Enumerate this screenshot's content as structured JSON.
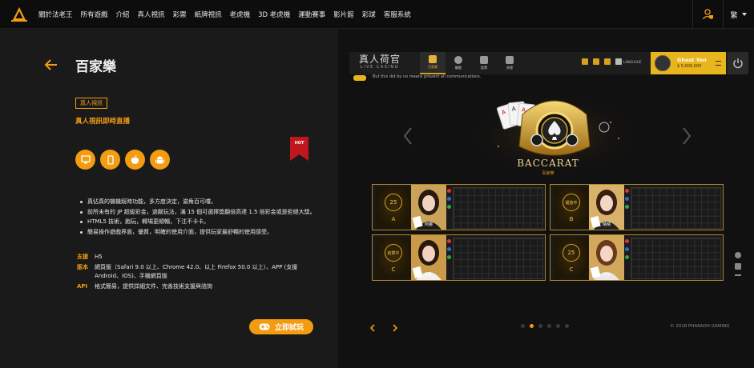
{
  "nav": {
    "items": [
      "關於法老王",
      "所有遊戲",
      "介紹",
      "真人視訊",
      "彩票",
      "紙牌視訊",
      "老虎機",
      "3D 老虎機",
      "運動賽事",
      "影片館",
      "彩球",
      "客服系統"
    ],
    "user_icon": "user-lock-icon",
    "language_label": "繁",
    "accent": "#f39c12"
  },
  "product": {
    "title": "百家樂",
    "tag": "真人視訊",
    "subtitle": "真人視訊即時直播",
    "hot_label": "HOT",
    "platforms": [
      "desktop-icon",
      "mobile-icon",
      "apple-icon",
      "android-icon"
    ],
    "features": [
      "真佔真的機機既時功能，多方度決定，滋角百可嚐。",
      "前所未有的 JP 超級彩金，過關玩法，滿 15 個可選擇獎翻倍高達 1.5 倍彩金或是拒絕大獎。",
      "HTML5 技術，跑玩，轉場更順暢，下注不卡卡。",
      "簡易操作遊戲界面，優質，明確的使用介面，提供玩家最舒暢的使用感受。"
    ],
    "specs": [
      {
        "key": "支援",
        "value": "H5"
      },
      {
        "key": "版本",
        "value": "網頁版（Safari 9.0 以上、Chrome 42.0、以上 Firefox 50.0 以上）、APP (支援 Android、IOS)、手機網頁版"
      },
      {
        "key": "API",
        "value": "格式簡易，提供詳細文件、完善技術支援與諮詢"
      }
    ],
    "try_label": "立即試玩"
  },
  "game": {
    "logo_main": "真人荷官",
    "logo_sub": "LIVE CASINO",
    "tabs": [
      {
        "label": "百家樂",
        "active": true
      },
      {
        "label": "輪盤",
        "active": false
      },
      {
        "label": "骰寶",
        "active": false
      },
      {
        "label": "多檯",
        "active": false
      }
    ],
    "language_label": "LANGUAGE",
    "player_name": "Ghost Yen",
    "player_balance": "$ 5,000,000",
    "ticker": "But this did by no means prevent all communications.",
    "game_title": "BACCARAT",
    "game_subtitle": "百家樂",
    "tables": [
      {
        "round": "25",
        "letter": "A",
        "dealer": "阿娜",
        "bead_icon": "bead-road-icon"
      },
      {
        "round": "開放中",
        "letter": "B",
        "dealer": "晴晴",
        "bead_icon": "bead-road-icon"
      },
      {
        "round": "結算中",
        "letter": "C",
        "dealer": "小安",
        "bead_icon": "bead-road-icon"
      },
      {
        "round": "25",
        "letter": "C",
        "dealer": "小安",
        "bead_icon": "bead-road-icon"
      }
    ],
    "side_labels": [
      "i",
      "▭",
      "≡"
    ],
    "pages": 6,
    "active_page": 2,
    "copyright": "© 2018 PHARAOH GAMING"
  }
}
